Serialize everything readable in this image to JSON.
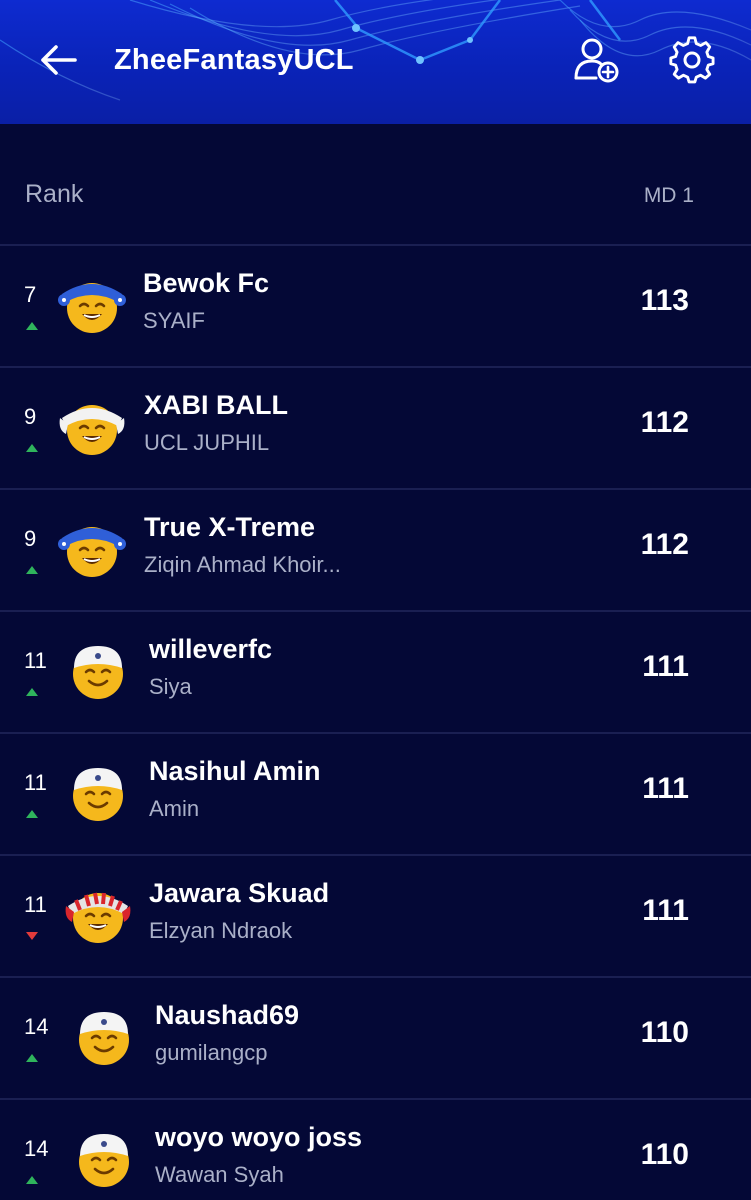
{
  "header": {
    "title": "ZheeFantasyUCL",
    "back_icon": "arrow-left-icon",
    "add_user_icon": "user-add-icon",
    "settings_icon": "gear-icon",
    "bg_color": "#0c26c0"
  },
  "table": {
    "rank_header": "Rank",
    "md_header": "MD 1",
    "rows": [
      {
        "rank": "7",
        "trend": "up",
        "team": "Bewok Fc",
        "manager": "SYAIF",
        "points": "113",
        "avatar": "blue-headband"
      },
      {
        "rank": "9",
        "trend": "up",
        "team": "XABI BALL",
        "manager": "UCL JUPHIL",
        "points": "112",
        "avatar": "white-headband"
      },
      {
        "rank": "9",
        "trend": "up",
        "team": "True X-Treme",
        "manager": "Ziqin Ahmad Khoir...",
        "points": "112",
        "avatar": "blue-headband"
      },
      {
        "rank": "11",
        "trend": "up",
        "team": "willeverfc",
        "manager": "Siya",
        "points": "111",
        "avatar": "white-cap"
      },
      {
        "rank": "11",
        "trend": "up",
        "team": "Nasihul Amin",
        "manager": "Amin",
        "points": "111",
        "avatar": "white-cap"
      },
      {
        "rank": "11",
        "trend": "down",
        "team": "Jawara Skuad",
        "manager": "Elzyan Ndraok",
        "points": "111",
        "avatar": "red-white-headband"
      },
      {
        "rank": "14",
        "trend": "up",
        "team": "Naushad69",
        "manager": "gumilangcp",
        "points": "110",
        "avatar": "white-cap"
      },
      {
        "rank": "14",
        "trend": "up",
        "team": "woyo woyo joss",
        "manager": "Wawan Syah",
        "points": "110",
        "avatar": "white-cap"
      }
    ]
  },
  "colors": {
    "background": "#040836",
    "trend_up": "#2fb45c",
    "trend_down": "#e23b3b",
    "secondary_text": "#aab0c8"
  }
}
